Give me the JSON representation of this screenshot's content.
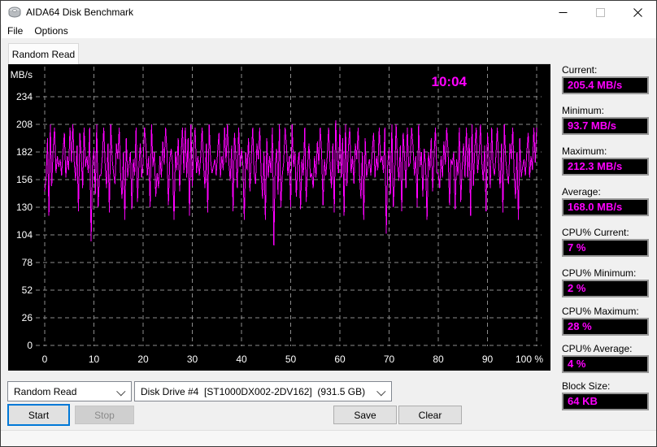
{
  "window": {
    "title": "AIDA64 Disk Benchmark"
  },
  "menu": {
    "items": [
      "File",
      "Options"
    ]
  },
  "tabs": {
    "active": "Random Read"
  },
  "chart_data": {
    "type": "line",
    "clock": "10:04",
    "ylabel": "MB/s",
    "yticks": [
      0,
      26,
      52,
      78,
      104,
      130,
      156,
      182,
      208,
      234
    ],
    "xticks": [
      "0",
      "10",
      "20",
      "30",
      "40",
      "50",
      "60",
      "70",
      "80",
      "90",
      "100 %"
    ],
    "xlim": [
      0,
      100
    ],
    "ylim": [
      0,
      260
    ],
    "grid": true,
    "background": "#000000",
    "grid_color": "#8c8c8c",
    "line_color": "#ff00ff",
    "label_color": "#ffffff",
    "series": [
      {
        "name": "Random Read",
        "values": [
          145,
          158,
          195,
          122,
          208,
          150,
          185,
          205,
          162,
          178,
          168,
          175,
          160,
          182,
          200,
          158,
          178,
          165,
          205,
          172,
          208,
          172,
          155,
          188,
          126,
          200,
          178,
          148,
          205,
          168,
          178,
          162,
          205,
          98,
          170,
          185,
          142,
          208,
          130,
          160,
          160,
          178,
          205,
          170,
          148,
          190,
          125,
          208,
          175,
          162,
          152,
          190,
          175,
          205,
          160,
          138,
          182,
          118,
          195,
          158,
          170,
          182,
          128,
          175,
          160,
          205,
          135,
          168,
          190,
          158,
          172,
          205,
          188,
          160,
          178,
          130,
          208,
          168,
          182,
          140,
          162,
          148,
          178,
          158,
          192,
          170,
          205,
          182,
          132,
          175,
          185,
          170,
          118,
          182,
          165,
          195,
          145,
          178,
          205,
          162,
          205,
          158,
          195,
          122,
          208,
          150,
          185,
          205,
          162,
          178,
          160,
          178,
          205,
          170,
          148,
          190,
          125,
          208,
          175,
          162,
          168,
          175,
          160,
          182,
          200,
          158,
          178,
          165,
          205,
          172,
          208,
          172,
          155,
          188,
          126,
          200,
          178,
          148,
          205,
          168,
          185,
          170,
          118,
          182,
          165,
          195,
          145,
          178,
          205,
          162,
          152,
          190,
          175,
          205,
          160,
          138,
          182,
          118,
          195,
          158,
          178,
          162,
          205,
          94,
          170,
          185,
          142,
          208,
          130,
          160,
          172,
          205,
          188,
          160,
          178,
          130,
          208,
          168,
          182,
          140,
          170,
          182,
          128,
          175,
          160,
          205,
          135,
          168,
          190,
          158,
          162,
          148,
          178,
          158,
          192,
          170,
          205,
          182,
          132,
          175,
          160,
          178,
          205,
          170,
          148,
          190,
          125,
          212,
          175,
          162,
          205,
          158,
          195,
          122,
          208,
          150,
          185,
          205,
          162,
          178,
          152,
          190,
          175,
          205,
          160,
          138,
          182,
          118,
          195,
          158,
          168,
          175,
          160,
          182,
          200,
          158,
          178,
          165,
          205,
          172,
          178,
          162,
          205,
          105,
          170,
          185,
          142,
          208,
          130,
          160,
          208,
          172,
          155,
          188,
          126,
          200,
          178,
          148,
          205,
          168,
          172,
          205,
          188,
          160,
          178,
          130,
          208,
          168,
          182,
          140,
          185,
          170,
          118,
          182,
          165,
          195,
          145,
          178,
          205,
          162,
          162,
          148,
          178,
          158,
          192,
          170,
          205,
          182,
          132,
          175,
          170,
          182,
          128,
          175,
          160,
          205,
          135,
          168,
          190,
          158,
          205,
          158,
          195,
          122,
          208,
          150,
          185,
          205,
          162,
          178,
          208,
          172,
          155,
          188,
          126,
          200,
          178,
          148,
          205,
          168,
          160,
          178,
          205,
          170,
          148,
          190,
          125,
          208,
          175,
          162,
          152,
          190,
          175,
          205,
          160,
          138,
          182,
          118,
          195,
          158,
          168,
          175,
          160,
          182,
          200,
          158,
          178,
          165,
          205,
          172,
          205
        ]
      }
    ]
  },
  "stats": [
    {
      "name": "current",
      "label": "Current:",
      "value": "205.4 MB/s"
    },
    {
      "name": "minimum",
      "label": "Minimum:",
      "value": "93.7 MB/s"
    },
    {
      "name": "maximum",
      "label": "Maximum:",
      "value": "212.3 MB/s"
    },
    {
      "name": "average",
      "label": "Average:",
      "value": "168.0 MB/s"
    },
    {
      "name": "cpu-current",
      "label": "CPU% Current:",
      "value": "7 %"
    },
    {
      "name": "cpu-minimum",
      "label": "CPU% Minimum:",
      "value": "2 %"
    },
    {
      "name": "cpu-maximum",
      "label": "CPU% Maximum:",
      "value": "28 %"
    },
    {
      "name": "cpu-average",
      "label": "CPU% Average:",
      "value": "4 %"
    },
    {
      "name": "block-size",
      "label": "Block Size:",
      "value": "64 KB"
    }
  ],
  "footer": {
    "test_select": "Random Read",
    "drive_select": "Disk Drive #4  [ST1000DX002-2DV162]  (931.5 GB)",
    "start_label": "Start",
    "stop_label": "Stop",
    "save_label": "Save",
    "clear_label": "Clear"
  }
}
